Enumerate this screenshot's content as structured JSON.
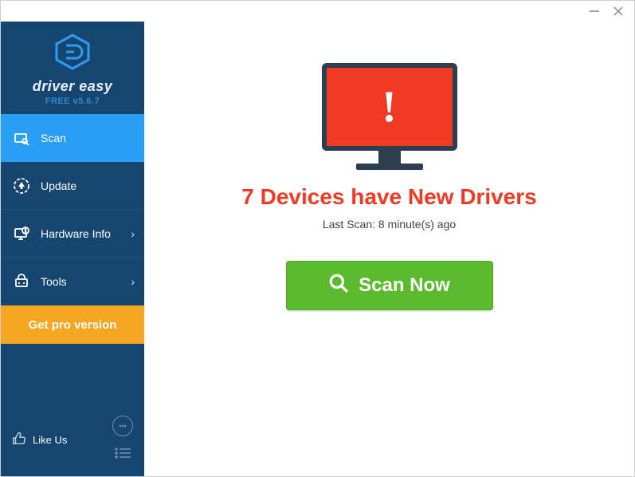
{
  "app": {
    "name": "driver easy",
    "version_label": "FREE v5.6.7"
  },
  "sidebar": {
    "items": [
      {
        "label": "Scan",
        "has_chevron": false
      },
      {
        "label": "Update",
        "has_chevron": false
      },
      {
        "label": "Hardware Info",
        "has_chevron": true
      },
      {
        "label": "Tools",
        "has_chevron": true
      }
    ],
    "get_pro_label": "Get pro version",
    "like_us_label": "Like Us"
  },
  "content": {
    "alert_glyph": "!",
    "headline": "7 Devices have New Drivers",
    "subline": "Last Scan: 8 minute(s) ago",
    "scan_button_label": "Scan Now"
  },
  "colors": {
    "sidebar_bg": "#164670",
    "active_item": "#2a9df4",
    "pro_btn": "#f5a623",
    "alert_red": "#f03a23",
    "scan_green": "#5bba2e"
  }
}
